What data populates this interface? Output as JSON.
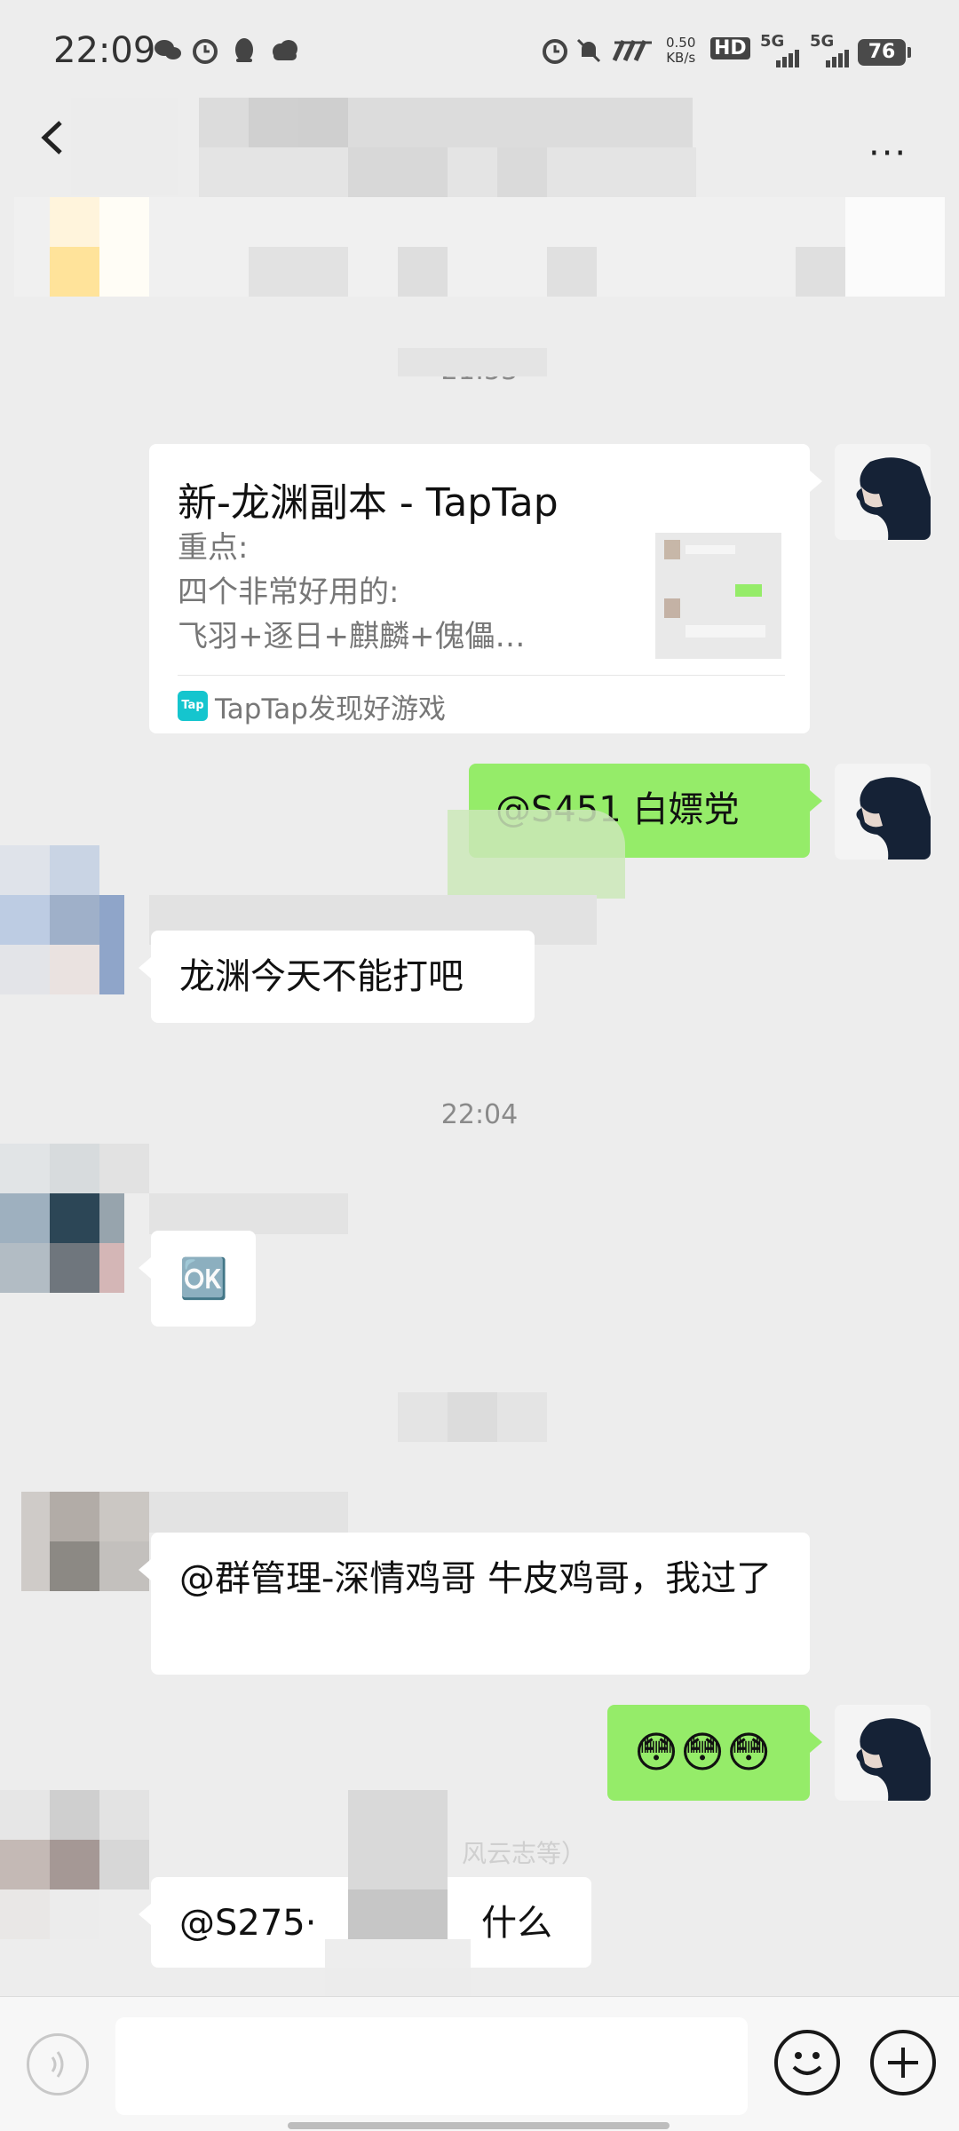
{
  "status_bar": {
    "time": "22:09",
    "net_speed_value": "0.50",
    "net_speed_unit": "KB/s",
    "hd_label": "HD",
    "signal_1": "5G",
    "signal_2": "5G",
    "battery": "76",
    "left_icons": [
      "wechat-icon",
      "alarm-icon",
      "qq-icon",
      "cloud-icon"
    ],
    "right_icons": [
      "alarm-icon",
      "mute-icon",
      "nfc-icon"
    ]
  },
  "title_bar": {
    "more_label": "···"
  },
  "messages": {
    "time_1": "21:53",
    "link_card": {
      "title": "新-龙渊副本 - TapTap",
      "desc_line_1": "重点:",
      "desc_line_2": "四个非常好用的:",
      "desc_line_3": " 飞羽+逐日+麒麟+傀儡…",
      "source": "TapTap发现好游戏",
      "source_icon_text": "Tap"
    },
    "sent_mention": "@S451 白嫖党",
    "received_1": "龙渊今天不能打吧",
    "time_2": "22:04",
    "received_ok": "🆗",
    "received_2": "@群管理-深情鸡哥  牛皮鸡哥，我过了",
    "sent_emoji": "😳😳😳",
    "system_hint": "风云志等）",
    "received_3_prefix": "@S275·",
    "received_3_suffix": "什么"
  },
  "input_bar": {
    "placeholder": ""
  }
}
